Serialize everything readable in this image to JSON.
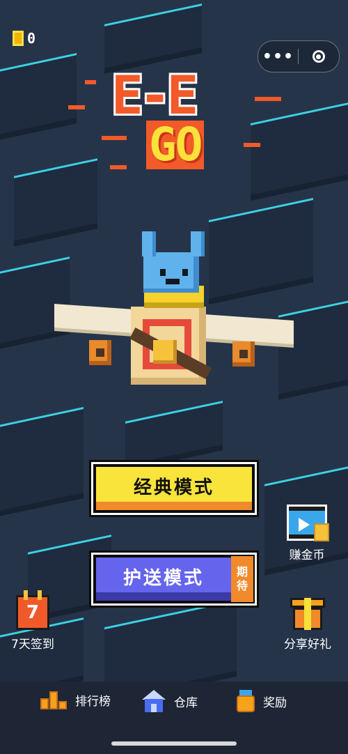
{
  "status": {
    "coin_count": "0"
  },
  "capsule": {
    "more_icon": "ellipsis-icon",
    "close_icon": "target-icon"
  },
  "logo": {
    "line1": "E-E",
    "line2": "GO"
  },
  "modes": {
    "classic_label": "经典模式",
    "escort_label": "护送模式",
    "escort_tag_line1": "期",
    "escort_tag_line2": "待"
  },
  "side": {
    "earn_coins_label": "赚金币",
    "share_gift_label": "分享好礼",
    "checkin_label": "7天签到",
    "checkin_day": "7"
  },
  "bottom_nav": [
    {
      "label": "排行榜",
      "icon": "podium-icon"
    },
    {
      "label": "仓库",
      "icon": "warehouse-icon"
    },
    {
      "label": "奖励",
      "icon": "medal-icon"
    }
  ],
  "colors": {
    "background": "#26344a",
    "accent_yellow": "#f8e43a",
    "accent_orange": "#f08a2a",
    "accent_purple": "#6464ec",
    "tile_edge": "#3cd2e6"
  }
}
